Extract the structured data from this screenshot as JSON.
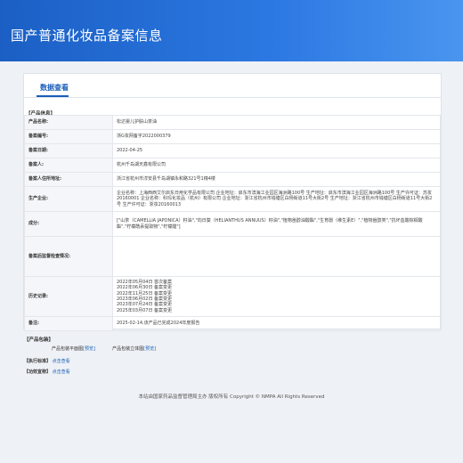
{
  "header": {
    "title": "国产普通化妆品备案信息"
  },
  "tabs": [
    {
      "label": "数据查看"
    }
  ],
  "product_info": {
    "section_title": "【产品信息】",
    "rows": [
      {
        "label": "产品名称:",
        "value": "松达婴儿护肤山茶油"
      },
      {
        "label": "备案编号:",
        "value": "浙G妆网备字2022000379"
      },
      {
        "label": "备案日期:",
        "value": "2022-04-25"
      },
      {
        "label": "备案人:",
        "value": "杭州千岛湖天鑫有限公司"
      },
      {
        "label": "备案人住所地址:",
        "value": "浙江省杭州市淳安县千岛湖镇永和路321号1幢4楼"
      },
      {
        "label": "生产企业:",
        "value": "企业名称：上海西西艾尔启东日用化学品有限公司 企业地址：启东市滨海工业园区海洲路100号 生产地址：启东市滨海工业园区海洲路100号 生产许可证：苏妆20160001 企业名称：科玛化妆品（杭州）有限公司 企业地址：浙江省杭州市钱塘区白杨街道11号大街2号 生产地址：浙江省杭州市钱塘区白杨街道11号大街2号 生产许可证：浙妆20160013"
      },
      {
        "label": "成分:",
        "value": "[\"山茶（CAMELLIA JAPONICA）籽油\",\"向日葵（HELIANTHUS ANNUUS）籽油\",\"植物甾醇油酸酯\",\"生育酚（维生素E）\",\"植物甾醇类\",\"抗坏血酸棕榈酸酯\",\"柠檬酰汞提取物\",\"柠檬醛\"]"
      },
      {
        "label": "备案后监督检查情况:",
        "value": ""
      },
      {
        "label": "历史记录:",
        "history": [
          "2022年05月04日 首次备案",
          "2022年06月30日 备案变更",
          "2022年11月25日 备案变更",
          "2023年06月02日 备案变更",
          "2023年07月24日 备案变更",
          "2025年03月07日 备案变更"
        ]
      },
      {
        "label": "备注:",
        "value": "2025-02-14,该产品已完成2024年度报告"
      }
    ]
  },
  "packaging": {
    "section_title": "【产品包装】",
    "flat_label": "产品包装平面图",
    "flat_link": "[预览]",
    "stereo_label": "产品包装立体图",
    "stereo_link": "[预览]"
  },
  "standard": {
    "section_title": "【执行标准】",
    "link": "点击查看"
  },
  "efficacy": {
    "section_title": "【功效宣称】",
    "link": "点击查看"
  },
  "footer": {
    "text": "本站由国家药品监督管理局主办 版权所有 Copyright © NMPA All Rights Reserved"
  }
}
